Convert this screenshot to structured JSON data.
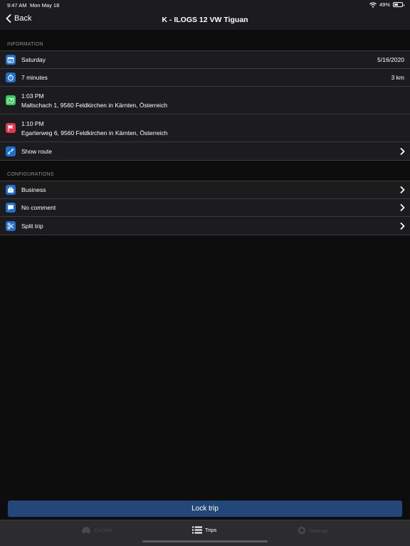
{
  "status_bar": {
    "time": "9:47 AM",
    "date": "Mon May 18",
    "battery": "49%"
  },
  "nav": {
    "back_label": "Back",
    "title": "K - ILOGS 12 VW Tiguan"
  },
  "information": {
    "header": "INFORMATION",
    "day": "Saturday",
    "date": "5/16/2020",
    "duration": "7 minutes",
    "distance": "3 km",
    "start_time": "1:03 PM",
    "start_address": "Maltschach 1, 9560 Feldkirchen in Kärnten, Österreich",
    "end_time": "1:10 PM",
    "end_address": "Egarterweg 6, 9560 Feldkirchen in Kärnten, Österreich",
    "show_route": "Show route"
  },
  "configurations": {
    "header": "CONFIGURATIONS",
    "type": "Business",
    "comment": "No comment",
    "split": "Split trip"
  },
  "lock_button": "Lock trip",
  "tabs": {
    "cockpit": "Cockpit",
    "trips": "Trips",
    "settings": "Settings"
  },
  "colors": {
    "accent_blue": "#24477a",
    "icon_blue": "#1f6fd1",
    "icon_green": "#34c759",
    "icon_red": "#e8344e"
  }
}
